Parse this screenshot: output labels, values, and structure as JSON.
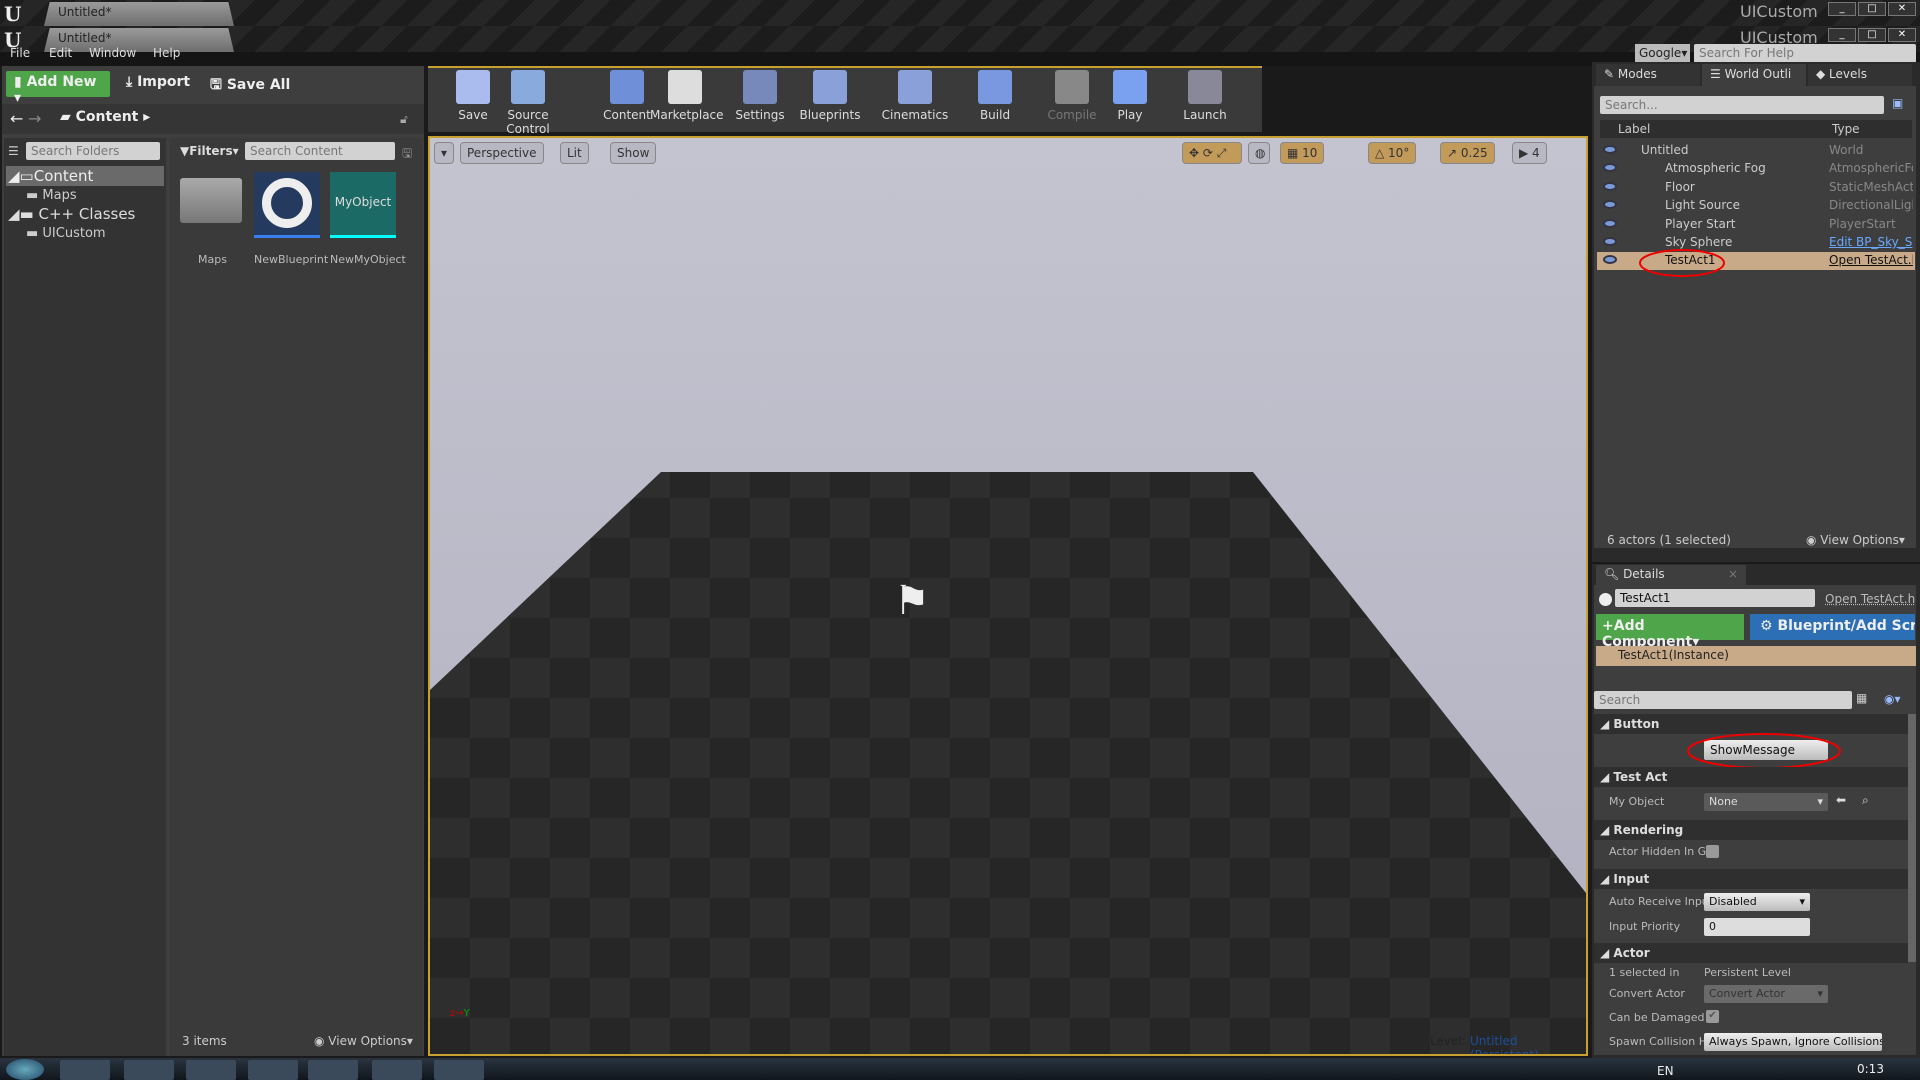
{
  "window": {
    "tab_title": "Untitled*",
    "project": "UIcustom",
    "project2": "UICustom"
  },
  "menu": [
    "File",
    "Edit",
    "Window",
    "Help"
  ],
  "help": {
    "engine": "Google",
    "placeholder": "Search For Help"
  },
  "content_browser": {
    "add_new": "Add New",
    "import": "Import",
    "save_all": "Save All",
    "breadcrumb": "Content",
    "search_folders": "Search Folders",
    "filters": "Filters",
    "search_content": "Search Content",
    "tree": [
      {
        "label": "Content",
        "level": 0
      },
      {
        "label": "Maps",
        "level": 1
      },
      {
        "label": "C++ Classes",
        "level": 0
      },
      {
        "label": "UICustom",
        "level": 1
      }
    ],
    "assets": [
      {
        "name": "Maps",
        "type": "folder"
      },
      {
        "name": "NewBlueprint",
        "type": "blueprint"
      },
      {
        "name": "NewMyObject",
        "type": "object",
        "thumb": "MyObject"
      }
    ],
    "item_count": "3 items",
    "view_options": "View Options"
  },
  "toolbar": [
    "Save",
    "Source Control",
    "Content",
    "Marketplace",
    "Settings",
    "Blueprints",
    "Cinematics",
    "Build",
    "Compile",
    "Play",
    "Launch"
  ],
  "viewport": {
    "perspective": "Perspective",
    "lit": "Lit",
    "show": "Show",
    "grid": "10",
    "rot": "10°",
    "scale": "0.25",
    "cam": "4",
    "level_label": "Level:",
    "level": "Untitled (Persistent)"
  },
  "outliner": {
    "tabs": [
      "Modes",
      "World Outli",
      "Levels"
    ],
    "search": "Search...",
    "col_label": "Label",
    "col_type": "Type",
    "rows": [
      {
        "label": "Untitled",
        "type": "World"
      },
      {
        "label": "Atmospheric Fog",
        "type": "AtmosphericFog"
      },
      {
        "label": "Floor",
        "type": "StaticMeshActor"
      },
      {
        "label": "Light Source",
        "type": "DirectionalLight"
      },
      {
        "label": "Player Start",
        "type": "PlayerStart"
      },
      {
        "label": "Sky Sphere",
        "type": "Edit BP_Sky_S"
      },
      {
        "label": "TestAct1",
        "type": "Open TestAct.h"
      }
    ],
    "footer": "6 actors (1 selected)",
    "view_options": "View Options"
  },
  "details": {
    "tab": "Details",
    "name": "TestAct1",
    "open": "Open TestAct.h",
    "add_component": "Add Component",
    "blueprint": "Blueprint/Add Scr",
    "instance": "TestAct1(Instance)",
    "search": "Search",
    "sections": {
      "button": "Button",
      "test_act": "Test Act",
      "rendering": "Rendering",
      "input": "Input",
      "actor": "Actor"
    },
    "show_message": "ShowMessage",
    "my_object_label": "My Object",
    "my_object": "None",
    "hidden_label": "Actor Hidden In Ga",
    "auto_label": "Auto Receive Inpu",
    "auto": "Disabled",
    "priority_label": "Input Priority",
    "priority": "0",
    "sel_label": "1 selected in",
    "sel": "Persistent Level",
    "convert_label": "Convert Actor",
    "convert": "Convert Actor",
    "damage_label": "Can be Damaged",
    "spawn_label": "Spawn Collision H",
    "spawn": "Always Spawn, Ignore Collisions"
  },
  "taskbar": {
    "lang": "EN",
    "time": "0:13"
  },
  "colors": {
    "accent_green": "#4ea54a",
    "accent_blue": "#2d6fb5",
    "selection": "#c8aa88",
    "annotation": "#e00000"
  }
}
